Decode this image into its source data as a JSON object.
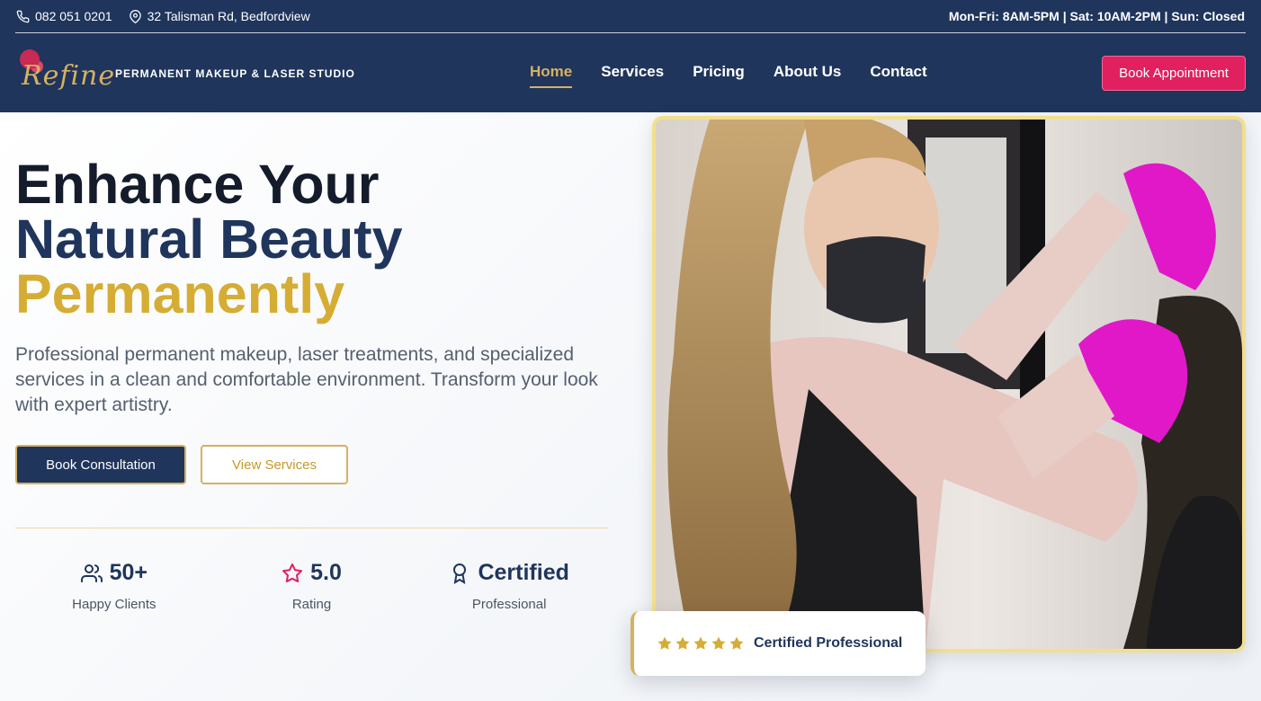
{
  "topbar": {
    "phone": "082 051 0201",
    "address": "32 Talisman Rd, Bedfordview",
    "hours": "Mon-Fri: 8AM-5PM | Sat: 10AM-2PM | Sun: Closed"
  },
  "header": {
    "logo_text": "Refine",
    "tagline": "PERMANENT MAKEUP & LASER STUDIO",
    "nav": [
      {
        "label": "Home",
        "active": true
      },
      {
        "label": "Services"
      },
      {
        "label": "Pricing"
      },
      {
        "label": "About Us"
      },
      {
        "label": "Contact"
      }
    ],
    "cta_label": "Book Appointment"
  },
  "hero": {
    "headline_1": "Enhance Your",
    "headline_2": "Natural Beauty",
    "headline_3": "Permanently",
    "description": "Professional permanent makeup, laser treatments, and specialized services in a clean and comfortable environment. Transform your look with expert artistry.",
    "primary_button": "Book Consultation",
    "secondary_button": "View Services",
    "stats": [
      {
        "value": "50+",
        "label": "Happy Clients",
        "icon": "users-icon"
      },
      {
        "value": "5.0",
        "label": "Rating",
        "icon": "star-icon"
      },
      {
        "value": "Certified",
        "label": "Professional",
        "icon": "award-icon"
      }
    ],
    "badge": {
      "text": "Certified Professional",
      "stars": 5
    }
  },
  "colors": {
    "navy": "#1f355c",
    "gold": "#d6ad34",
    "pink": "#e0205f"
  }
}
